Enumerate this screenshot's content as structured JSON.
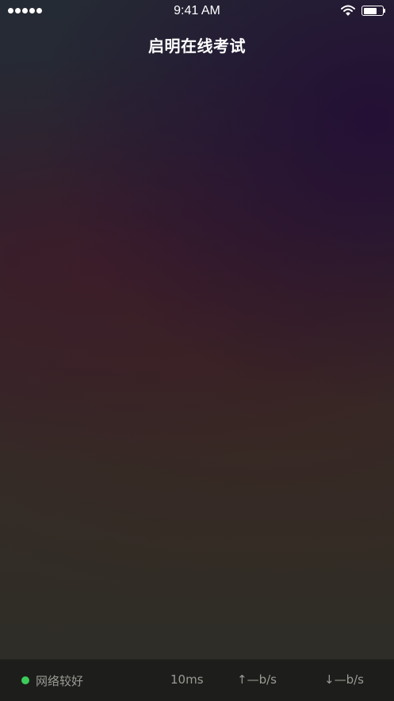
{
  "status_bar": {
    "time": "9:41 AM",
    "signal_bars": 5,
    "battery_level": 0.72,
    "icons": [
      "signal-icon",
      "wifi-icon",
      "battery-icon"
    ]
  },
  "header": {
    "title": "启明在线考试"
  },
  "footer": {
    "network_status": "网络较好",
    "network_status_color": "#3ccc5a",
    "latency": "10ms",
    "upload": "↑—b/s",
    "download": "↓—b/s"
  }
}
